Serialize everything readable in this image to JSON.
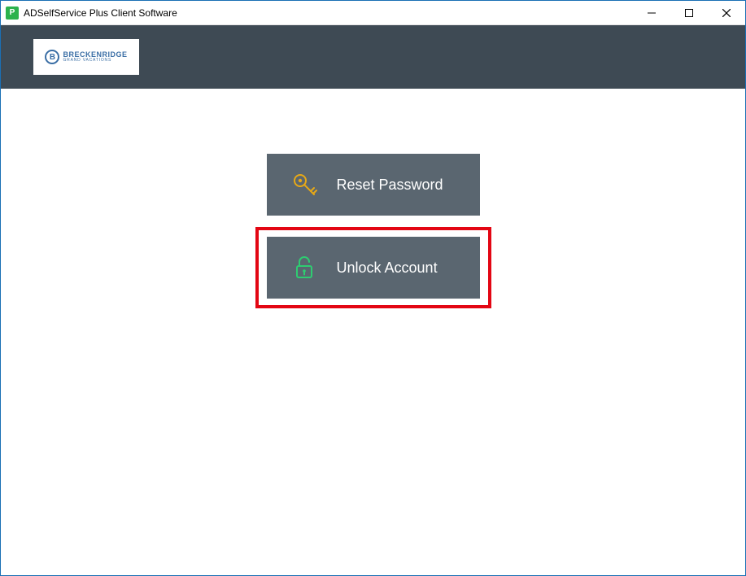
{
  "window": {
    "title": "ADSelfService Plus Client Software"
  },
  "logo": {
    "brand_main": "BRECKENRIDGE",
    "brand_sub": "GRAND VACATIONS",
    "mark_letter": "B"
  },
  "actions": {
    "reset_password": {
      "label": "Reset Password"
    },
    "unlock_account": {
      "label": "Unlock Account"
    }
  }
}
